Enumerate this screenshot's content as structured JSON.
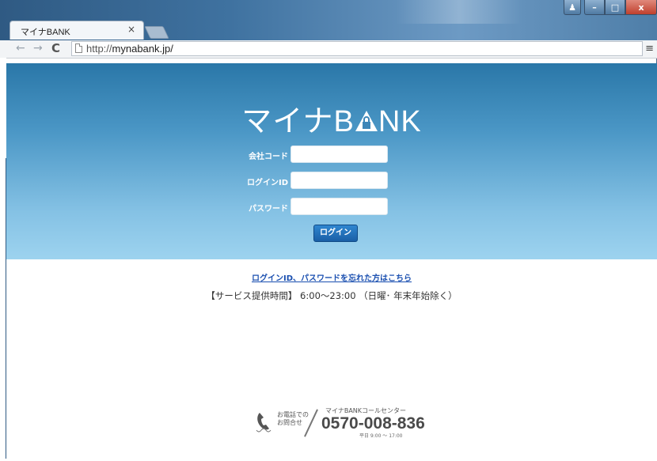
{
  "browser": {
    "tab_title": "マイナBANK",
    "tab_close": "×",
    "url_prefix": "http://",
    "url_domain": "mynabank.jp/",
    "controls": {
      "user": "♟",
      "minimize": "–",
      "maximize": "□",
      "close": "x"
    },
    "nav": {
      "back": "←",
      "forward": "→",
      "reload": "C",
      "menu": "≡"
    }
  },
  "page": {
    "logo": {
      "text_before": "マイナB",
      "text_after": "NK"
    },
    "form": {
      "company_code_label": "会社コード",
      "login_id_label": "ログインID",
      "password_label": "パスワード",
      "company_code_value": "",
      "login_id_value": "",
      "password_value": ""
    },
    "login_button": "ログイン",
    "forgot_link": "ログインID、パスワードを忘れた方はこちら",
    "service_hours": "【サービス提供時間】 6:00〜23:00 （日曜･ 年末年始除く）",
    "contact": {
      "line1": "お電話での",
      "line2": "お問合せ",
      "center_name": "マイナBANKコールセンター",
      "phone": "0570-008-836",
      "hours": "平日 9:00 〜 17:00"
    }
  },
  "colors": {
    "hero_top": "#2a77a8",
    "hero_bottom": "#9dd3ef",
    "button": "#1a5fa6",
    "link": "#1a4fb0"
  }
}
